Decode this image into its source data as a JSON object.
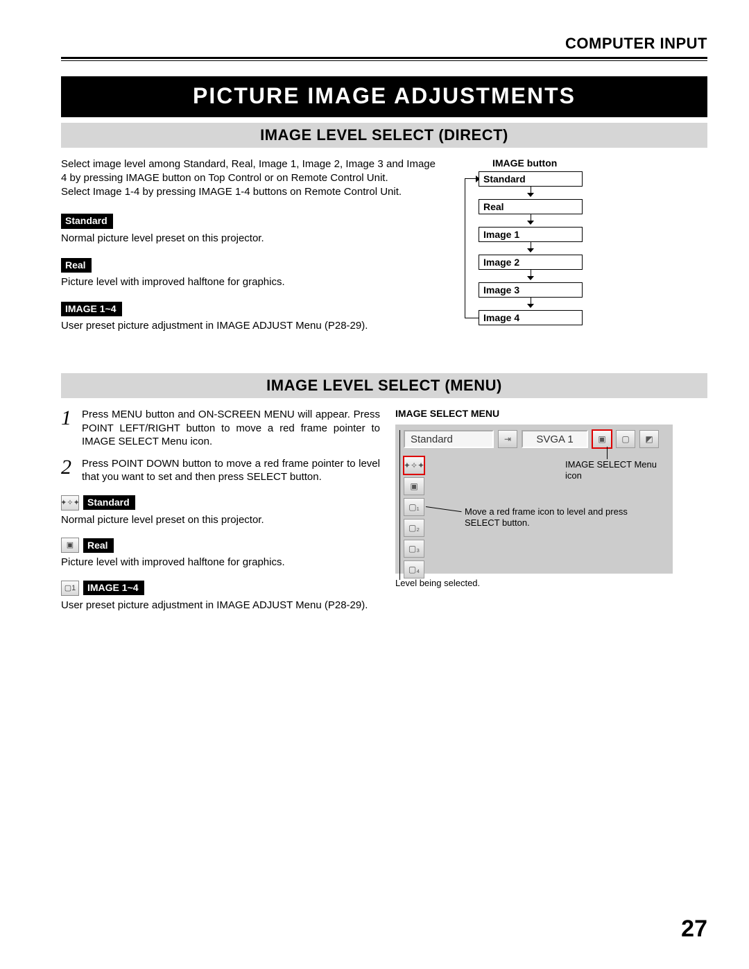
{
  "page": {
    "section_label": "COMPUTER INPUT",
    "title": "PICTURE IMAGE ADJUSTMENTS",
    "number": "27"
  },
  "direct": {
    "heading": "IMAGE LEVEL SELECT (DIRECT)",
    "intro": "Select image level among Standard, Real, Image 1, Image 2, Image 3 and Image 4 by pressing IMAGE button on Top Control or on Remote Control Unit.\nSelect Image 1-4 by pressing IMAGE 1-4 buttons on Remote Control Unit.",
    "items": [
      {
        "label": "Standard",
        "desc": "Normal picture level preset on this projector."
      },
      {
        "label": "Real",
        "desc": "Picture level with improved halftone for graphics."
      },
      {
        "label": "IMAGE 1~4",
        "desc": "User preset picture adjustment in IMAGE ADJUST Menu (P28-29)."
      }
    ],
    "flow_title": "IMAGE button",
    "flow": [
      "Standard",
      "Real",
      "Image 1",
      "Image 2",
      "Image 3",
      "Image 4"
    ]
  },
  "menu": {
    "heading": "IMAGE LEVEL SELECT (MENU)",
    "steps": [
      "Press MENU button and ON-SCREEN MENU will appear.  Press POINT LEFT/RIGHT button to move a red frame pointer to IMAGE SELECT Menu icon.",
      "Press POINT DOWN button to move a red frame pointer to level that you want to set and then press SELECT button."
    ],
    "items": [
      {
        "icon": "diamonds-icon",
        "glyph": "✦✧✦",
        "label": "Standard",
        "desc": "Normal picture level preset on this projector."
      },
      {
        "icon": "monitor-icon",
        "glyph": "▣",
        "label": "Real",
        "desc": "Picture level with improved halftone for graphics."
      },
      {
        "icon": "preset1-icon",
        "glyph": "▢1",
        "label": "IMAGE 1~4",
        "desc": "User preset picture adjustment in IMAGE ADJUST Menu (P28-29)."
      }
    ],
    "diagram": {
      "title": "IMAGE SELECT MENU",
      "field_text": "Standard",
      "mode_text": "SVGA 1",
      "note_icon": "IMAGE SELECT Menu icon",
      "note_move": "Move a red frame icon to level and press SELECT button.",
      "note_sel": "Level being selected.",
      "side_glyphs": [
        "✦✧✦",
        "▣",
        "▢₁",
        "▢₂",
        "▢₃",
        "▢₄"
      ]
    }
  }
}
